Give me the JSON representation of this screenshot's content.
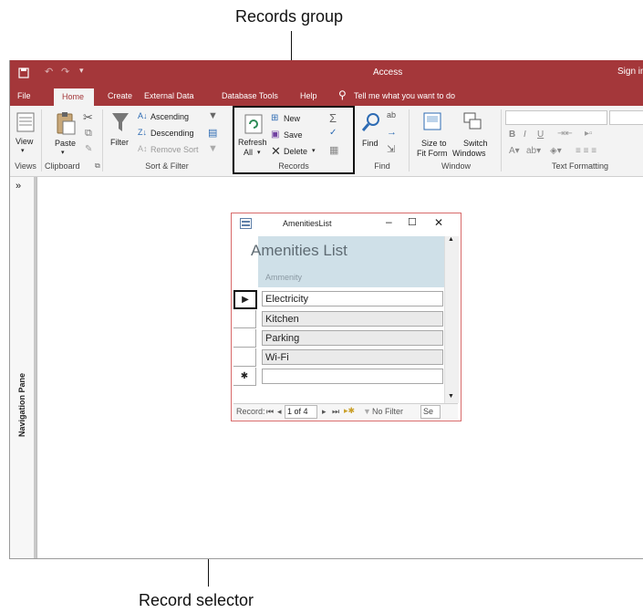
{
  "callouts": {
    "records_group": "Records group",
    "record_selector": "Record selector"
  },
  "titlebar": {
    "title": "Access",
    "sign_in": "Sign in"
  },
  "tabs": [
    "File",
    "Home",
    "Create",
    "External Data",
    "Database Tools",
    "Help"
  ],
  "tell_me": "Tell me what you want to do",
  "ribbon": {
    "views": {
      "label": "Views",
      "view": "View"
    },
    "clipboard": {
      "label": "Clipboard",
      "paste": "Paste"
    },
    "sort_filter": {
      "label": "Sort & Filter",
      "filter": "Filter",
      "ascending": "Ascending",
      "descending": "Descending",
      "remove_sort": "Remove Sort"
    },
    "records": {
      "label": "Records",
      "refresh_all_1": "Refresh",
      "refresh_all_2": "All",
      "new": "New",
      "save": "Save",
      "delete": "Delete"
    },
    "find": {
      "label": "Find",
      "find": "Find"
    },
    "window": {
      "label": "Window",
      "size_to_1": "Size to",
      "size_to_2": "Fit Form",
      "switch_1": "Switch",
      "switch_2": "Windows"
    },
    "text_formatting": {
      "label": "Text Formatting"
    }
  },
  "nav_pane": {
    "label": "Navigation Pane",
    "expand": "»"
  },
  "form": {
    "window_title": "AmenitiesList",
    "heading": "Amenities List",
    "column_label": "Ammenity",
    "rows": [
      "Electricity",
      "Kitchen",
      "Parking",
      "Wi-Fi",
      ""
    ],
    "record_nav": {
      "label": "Record:",
      "position": "1 of 4",
      "filter": "No Filter",
      "search": "Se"
    }
  },
  "colors": {
    "accent": "#a4373a",
    "form_header": "#cfe0e8",
    "form_border": "#d86a6a"
  }
}
